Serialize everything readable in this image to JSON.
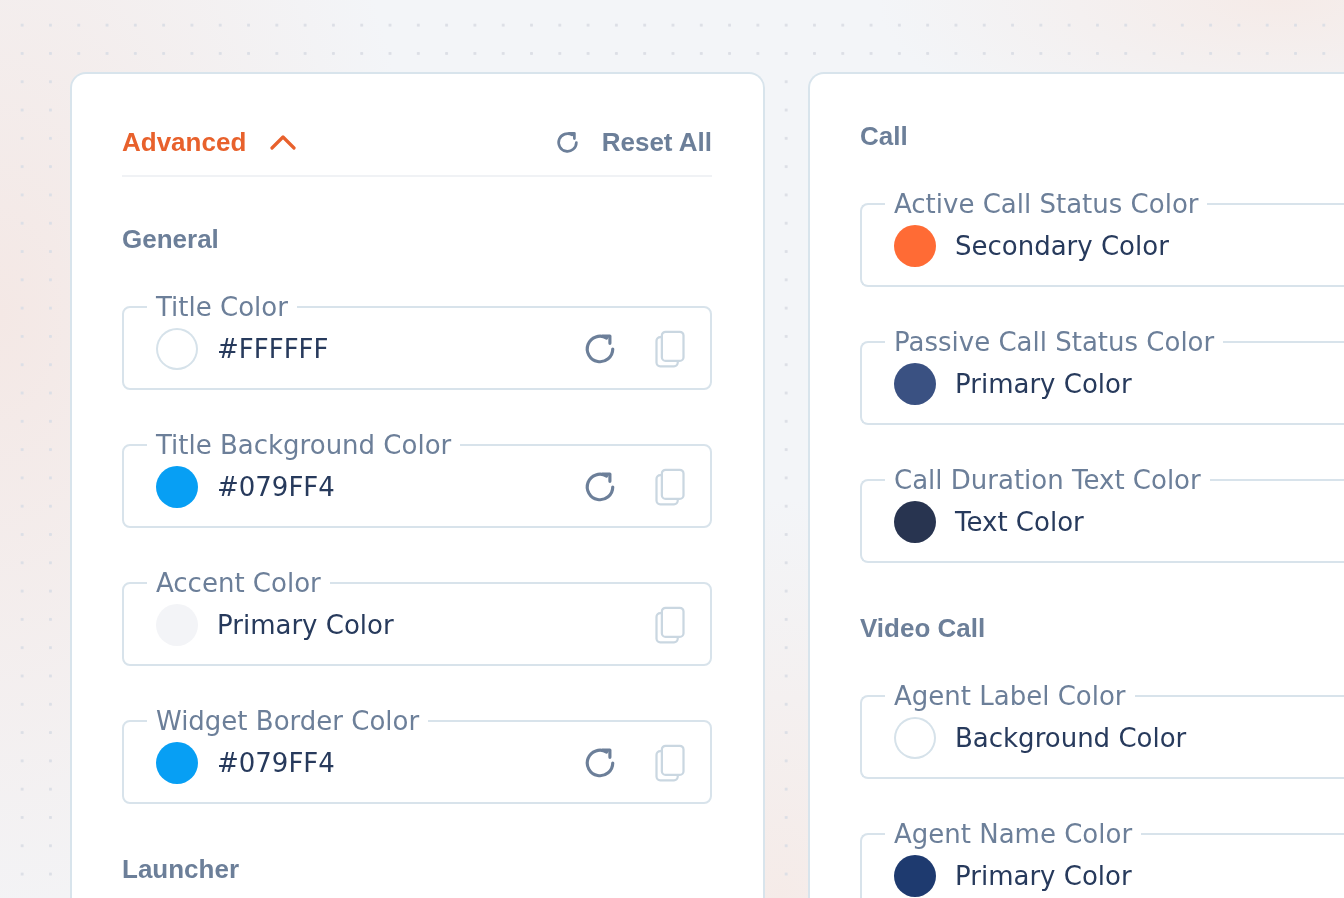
{
  "panels": [
    {
      "header": {
        "toggle": {
          "label": "Advanced",
          "expanded": true
        },
        "reset_all": {
          "label": "Reset All"
        }
      },
      "sections": [
        {
          "title": "General",
          "fields": [
            {
              "label": "Title Color",
              "value": "#FFFFFF",
              "color": "#ffffff",
              "actions": [
                {
                  "kind": "reset"
                },
                {
                  "kind": "copy"
                }
              ]
            },
            {
              "label": "Title Background Color",
              "value": "#079FF4",
              "color": "#079ff4",
              "actions": [
                {
                  "kind": "reset"
                },
                {
                  "kind": "copy"
                }
              ]
            },
            {
              "label": "Accent Color",
              "value": "Primary Color",
              "color": "#f3f4f7",
              "actions": [
                {
                  "kind": "copy"
                }
              ]
            },
            {
              "label": "Widget Border Color",
              "value": "#079FF4",
              "color": "#079ff4",
              "actions": [
                {
                  "kind": "reset"
                },
                {
                  "kind": "copy"
                }
              ]
            }
          ]
        },
        {
          "title": "Launcher"
        }
      ]
    },
    {
      "sections": [
        {
          "title": "Call",
          "fields": [
            {
              "label": "Active Call Status Color",
              "value": "Secondary Color",
              "color": "#ff6b35"
            },
            {
              "label": "Passive Call Status Color",
              "value": "Primary Color",
              "color": "#3a5182"
            },
            {
              "label": "Call Duration Text Color",
              "value": "Text Color",
              "color": "#283450"
            }
          ]
        },
        {
          "title": "Video Call",
          "fields": [
            {
              "label": "Agent Label Color",
              "value": "Background Color",
              "color": "#ffffff"
            },
            {
              "label": "Agent Name Color",
              "value": "Primary Color",
              "color": "#1e3a6f"
            }
          ]
        }
      ]
    }
  ]
}
